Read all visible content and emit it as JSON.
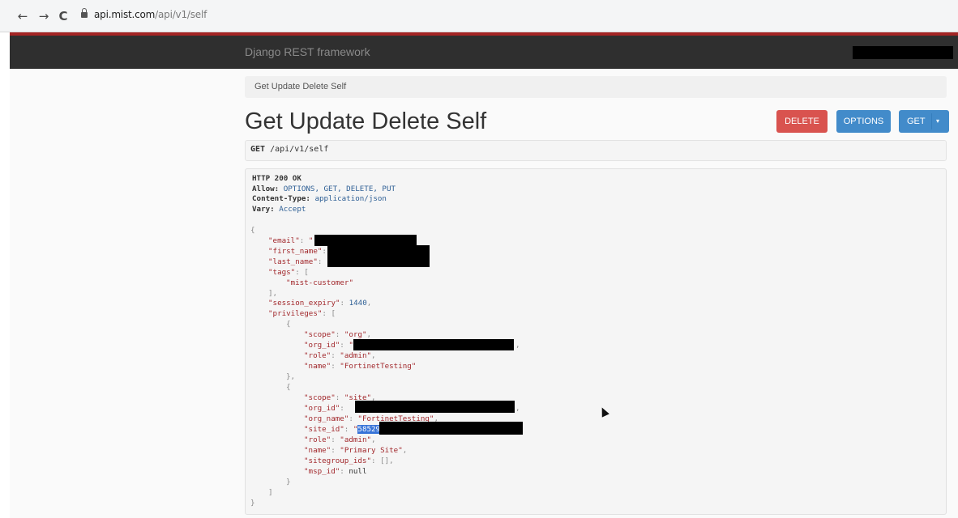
{
  "browser": {
    "back": "←",
    "forward": "→",
    "reload": "C",
    "url_host": "api.mist.com",
    "url_path": "/api/v1/self"
  },
  "navbar": {
    "brand": "Django REST framework"
  },
  "breadcrumb": "Get Update Delete Self",
  "page_title": "Get Update Delete Self",
  "buttons": {
    "delete": "DELETE",
    "options": "OPTIONS",
    "get": "GET",
    "get_caret": "▾"
  },
  "request": {
    "method": "GET",
    "path": "/api/v1/self"
  },
  "response_headers": [
    {
      "key": "HTTP 200 OK",
      "value": ""
    },
    {
      "key": "Allow:",
      "value": " OPTIONS, GET, DELETE, PUT"
    },
    {
      "key": "Content-Type:",
      "value": " application/json"
    },
    {
      "key": "Vary:",
      "value": " Accept"
    }
  ],
  "json_body": {
    "email_key": "\"email\"",
    "email_open": "\"",
    "first_name_key": "\"first_name\"",
    "last_name_key": "\"last_name\"",
    "tags_key": "\"tags\"",
    "tag_0": "\"mist-customer\"",
    "session_expiry_key": "\"session_expiry\"",
    "session_expiry": "1440",
    "privileges_key": "\"privileges\"",
    "p0_scope_key": "\"scope\"",
    "p0_scope": "\"org\"",
    "p0_org_id_key": "\"org_id\"",
    "p0_org_id_open": "\"",
    "p0_role_key": "\"role\"",
    "p0_role": "\"admin\"",
    "p0_name_key": "\"name\"",
    "p0_name": "\"FortinetTesting\"",
    "p1_scope_key": "\"scope\"",
    "p1_scope": "\"site\"",
    "p1_org_id_key": "\"org_id\"",
    "p1_org_name_key": "\"org_name\"",
    "p1_org_name": "\"FortinetTesting\"",
    "p1_site_id_key": "\"site_id\"",
    "p1_site_id_open": "\"",
    "p1_site_id_visible": "58529",
    "p1_role_key": "\"role\"",
    "p1_role": "\"admin\"",
    "p1_name_key": "\"name\"",
    "p1_name": "\"Primary Site\"",
    "p1_sitegroup_ids_key": "\"sitegroup_ids\"",
    "p1_sitegroup_ids": "[]",
    "p1_msp_id_key": "\"msp_id\"",
    "p1_msp_id": "null"
  }
}
